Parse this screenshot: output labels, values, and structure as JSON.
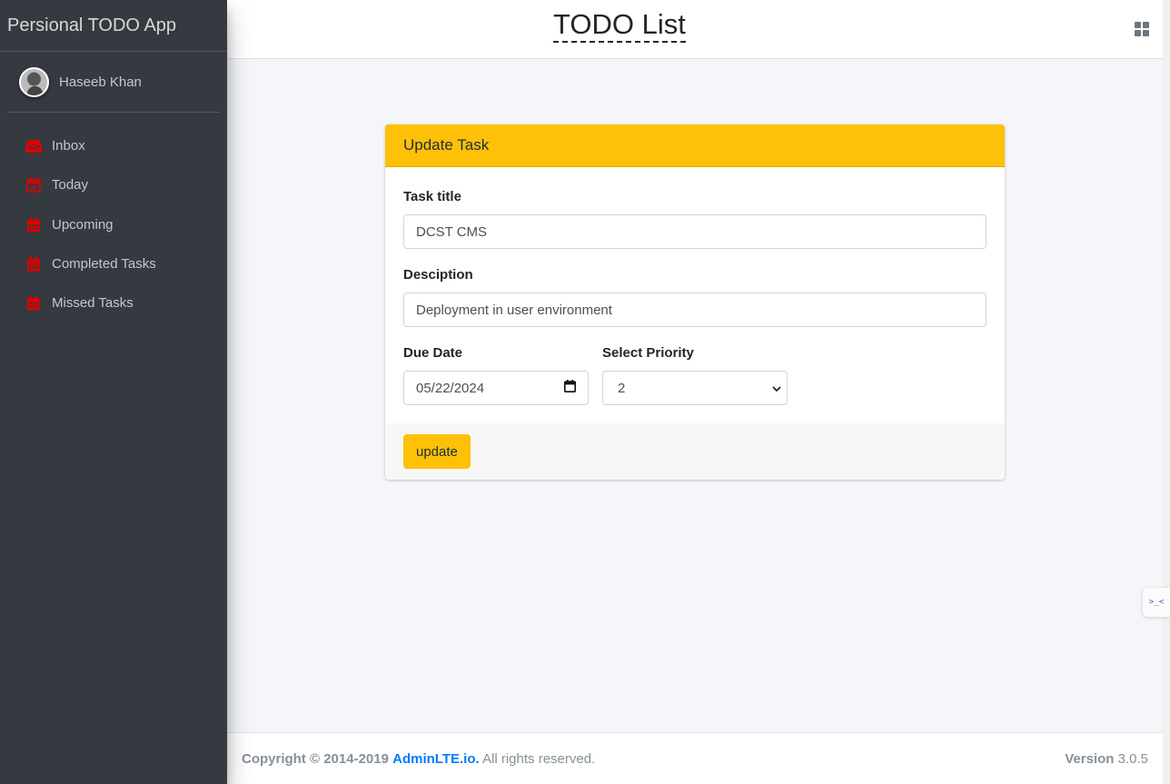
{
  "sidebar": {
    "brand": "Persional TODO App",
    "user_name": "Haseeb Khan",
    "items": [
      {
        "label": "Inbox",
        "icon": "inbox-icon"
      },
      {
        "label": "Today",
        "icon": "calendar-check-icon"
      },
      {
        "label": "Upcoming",
        "icon": "calendar-icon"
      },
      {
        "label": "Completed Tasks",
        "icon": "calendar-icon"
      },
      {
        "label": "Missed Tasks",
        "icon": "calendar-icon"
      }
    ],
    "icon_color": "#dc0000"
  },
  "header": {
    "title": "TODO List"
  },
  "card": {
    "title": "Update Task",
    "task_title_label": "Task title",
    "task_title_value": "DCST CMS",
    "description_label": "Desciption",
    "description_value": "Deployment in user environment",
    "due_date_label": "Due Date",
    "due_date_value": "05/22/2024",
    "priority_label": "Select Priority",
    "priority_value": "2",
    "update_button": "update",
    "accent_color": "#ffc107"
  },
  "footer": {
    "copyright_prefix": "Copyright © 2014-2019",
    "brand": "AdminLTE.io.",
    "rights": "All rights reserved.",
    "version_label": "Version",
    "version_value": "3.0.5"
  },
  "widget": {
    "glyph": ">_<"
  }
}
